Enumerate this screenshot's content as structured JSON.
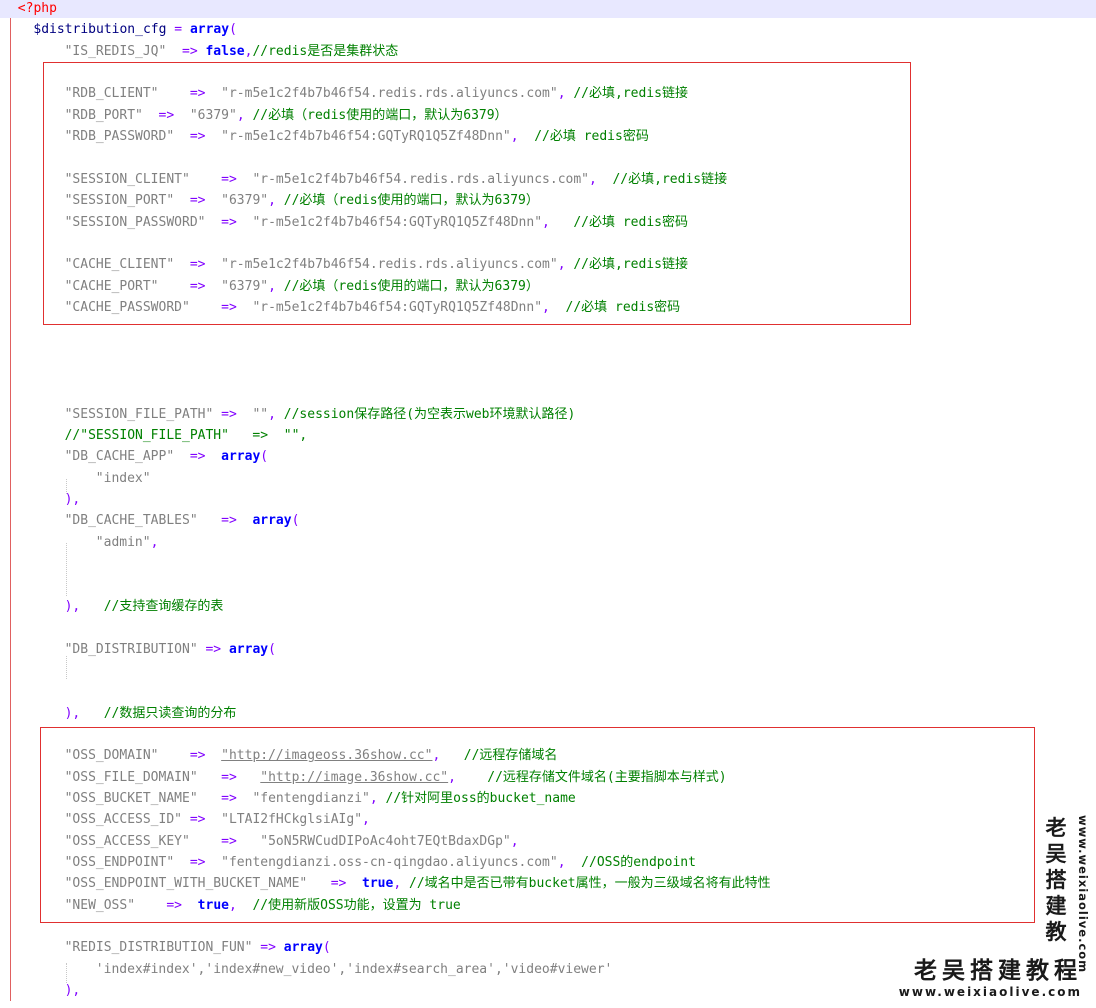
{
  "lines": [
    {
      "indent": 1,
      "segs": [
        {
          "c": "tag",
          "t": "<?php"
        }
      ]
    },
    {
      "indent": 3,
      "segs": [
        {
          "c": "var",
          "t": "$distribution_cfg"
        },
        {
          "c": "op",
          "t": " = "
        },
        {
          "c": "kw",
          "t": "array"
        },
        {
          "c": "op",
          "t": "("
        }
      ]
    },
    {
      "indent": 7,
      "segs": [
        {
          "c": "str",
          "t": "\"IS_REDIS_JQ\""
        },
        {
          "c": "op",
          "t": "  => "
        },
        {
          "c": "kw",
          "t": "false"
        },
        {
          "c": "op",
          "t": ","
        },
        {
          "c": "cm",
          "t": "//redis是否是集群状态"
        }
      ]
    },
    {
      "indent": 0,
      "segs": []
    },
    {
      "indent": 7,
      "segs": [
        {
          "c": "str",
          "t": "\"RDB_CLIENT\""
        },
        {
          "c": "op",
          "t": "    =>  "
        },
        {
          "c": "str",
          "t": "\"r-m5e1c2f4b7b46f54.redis.rds.aliyuncs.com\""
        },
        {
          "c": "op",
          "t": ", "
        },
        {
          "c": "cm",
          "t": "//必填,redis链接"
        }
      ]
    },
    {
      "indent": 7,
      "segs": [
        {
          "c": "str",
          "t": "\"RDB_PORT\""
        },
        {
          "c": "op",
          "t": "  =>  "
        },
        {
          "c": "str",
          "t": "\"6379\""
        },
        {
          "c": "op",
          "t": ", "
        },
        {
          "c": "cm",
          "t": "//必填（redis使用的端口，默认为6379）"
        }
      ]
    },
    {
      "indent": 7,
      "segs": [
        {
          "c": "str",
          "t": "\"RDB_PASSWORD\""
        },
        {
          "c": "op",
          "t": "  =>  "
        },
        {
          "c": "str",
          "t": "\"r-m5e1c2f4b7b46f54:GQTyRQ1Q5Zf48Dnn\""
        },
        {
          "c": "op",
          "t": ",  "
        },
        {
          "c": "cm",
          "t": "//必填 redis密码"
        }
      ]
    },
    {
      "indent": 0,
      "segs": []
    },
    {
      "indent": 7,
      "segs": [
        {
          "c": "str",
          "t": "\"SESSION_CLIENT\""
        },
        {
          "c": "op",
          "t": "    =>  "
        },
        {
          "c": "str",
          "t": "\"r-m5e1c2f4b7b46f54.redis.rds.aliyuncs.com\""
        },
        {
          "c": "op",
          "t": ",  "
        },
        {
          "c": "cm",
          "t": "//必填,redis链接"
        }
      ]
    },
    {
      "indent": 7,
      "segs": [
        {
          "c": "str",
          "t": "\"SESSION_PORT\""
        },
        {
          "c": "op",
          "t": "  =>  "
        },
        {
          "c": "str",
          "t": "\"6379\""
        },
        {
          "c": "op",
          "t": ", "
        },
        {
          "c": "cm",
          "t": "//必填（redis使用的端口，默认为6379）"
        }
      ]
    },
    {
      "indent": 7,
      "segs": [
        {
          "c": "str",
          "t": "\"SESSION_PASSWORD\""
        },
        {
          "c": "op",
          "t": "  =>  "
        },
        {
          "c": "str",
          "t": "\"r-m5e1c2f4b7b46f54:GQTyRQ1Q5Zf48Dnn\""
        },
        {
          "c": "op",
          "t": ",   "
        },
        {
          "c": "cm",
          "t": "//必填 redis密码"
        }
      ]
    },
    {
      "indent": 0,
      "segs": []
    },
    {
      "indent": 7,
      "segs": [
        {
          "c": "str",
          "t": "\"CACHE_CLIENT\""
        },
        {
          "c": "op",
          "t": "  =>  "
        },
        {
          "c": "str",
          "t": "\"r-m5e1c2f4b7b46f54.redis.rds.aliyuncs.com\""
        },
        {
          "c": "op",
          "t": ", "
        },
        {
          "c": "cm",
          "t": "//必填,redis链接"
        }
      ]
    },
    {
      "indent": 7,
      "segs": [
        {
          "c": "str",
          "t": "\"CACHE_PORT\""
        },
        {
          "c": "op",
          "t": "    =>  "
        },
        {
          "c": "str",
          "t": "\"6379\""
        },
        {
          "c": "op",
          "t": ", "
        },
        {
          "c": "cm",
          "t": "//必填（redis使用的端口，默认为6379）"
        }
      ]
    },
    {
      "indent": 7,
      "segs": [
        {
          "c": "str",
          "t": "\"CACHE_PASSWORD\""
        },
        {
          "c": "op",
          "t": "    =>  "
        },
        {
          "c": "str",
          "t": "\"r-m5e1c2f4b7b46f54:GQTyRQ1Q5Zf48Dnn\""
        },
        {
          "c": "op",
          "t": ",  "
        },
        {
          "c": "cm",
          "t": "//必填 redis密码"
        }
      ]
    },
    {
      "indent": 0,
      "segs": []
    },
    {
      "indent": 0,
      "segs": []
    },
    {
      "indent": 0,
      "segs": []
    },
    {
      "indent": 0,
      "segs": []
    },
    {
      "indent": 7,
      "segs": [
        {
          "c": "str",
          "t": "\"SESSION_FILE_PATH\""
        },
        {
          "c": "op",
          "t": " =>  "
        },
        {
          "c": "str",
          "t": "\"\""
        },
        {
          "c": "op",
          "t": ", "
        },
        {
          "c": "cm",
          "t": "//session保存路径(为空表示web环境默认路径)"
        }
      ]
    },
    {
      "indent": 7,
      "segs": [
        {
          "c": "cm",
          "t": "//\"SESSION_FILE_PATH\"   =>  \"\","
        }
      ]
    },
    {
      "indent": 7,
      "segs": [
        {
          "c": "str",
          "t": "\"DB_CACHE_APP\""
        },
        {
          "c": "op",
          "t": "  =>  "
        },
        {
          "c": "kw",
          "t": "array"
        },
        {
          "c": "op",
          "t": "("
        }
      ]
    },
    {
      "indent": 11,
      "segs": [
        {
          "c": "str",
          "t": "\"index\""
        }
      ]
    },
    {
      "indent": 7,
      "segs": [
        {
          "c": "op",
          "t": "),"
        }
      ]
    },
    {
      "indent": 7,
      "segs": [
        {
          "c": "str",
          "t": "\"DB_CACHE_TABLES\""
        },
        {
          "c": "op",
          "t": "   =>  "
        },
        {
          "c": "kw",
          "t": "array"
        },
        {
          "c": "op",
          "t": "("
        }
      ]
    },
    {
      "indent": 11,
      "segs": [
        {
          "c": "str",
          "t": "\"admin\""
        },
        {
          "c": "op",
          "t": ","
        }
      ]
    },
    {
      "indent": 0,
      "segs": []
    },
    {
      "indent": 0,
      "segs": []
    },
    {
      "indent": 7,
      "segs": [
        {
          "c": "op",
          "t": "),   "
        },
        {
          "c": "cm",
          "t": "//支持查询缓存的表"
        }
      ]
    },
    {
      "indent": 0,
      "segs": []
    },
    {
      "indent": 7,
      "segs": [
        {
          "c": "str",
          "t": "\"DB_DISTRIBUTION\""
        },
        {
          "c": "op",
          "t": " => "
        },
        {
          "c": "kw",
          "t": "array"
        },
        {
          "c": "op",
          "t": "("
        }
      ]
    },
    {
      "indent": 0,
      "segs": []
    },
    {
      "indent": 0,
      "segs": []
    },
    {
      "indent": 7,
      "segs": [
        {
          "c": "op",
          "t": "),   "
        },
        {
          "c": "cm",
          "t": "//数据只读查询的分布"
        }
      ]
    },
    {
      "indent": 0,
      "segs": []
    },
    {
      "indent": 7,
      "segs": [
        {
          "c": "str",
          "t": "\"OSS_DOMAIN\""
        },
        {
          "c": "op",
          "t": "    =>  "
        },
        {
          "c": "lnk",
          "t": "\"http://imageoss.36show.cc\""
        },
        {
          "c": "op",
          "t": ",   "
        },
        {
          "c": "cm",
          "t": "//远程存储域名"
        }
      ]
    },
    {
      "indent": 7,
      "segs": [
        {
          "c": "str",
          "t": "\"OSS_FILE_DOMAIN\""
        },
        {
          "c": "op",
          "t": "   =>   "
        },
        {
          "c": "lnk",
          "t": "\"http://image.36show.cc\""
        },
        {
          "c": "op",
          "t": ",    "
        },
        {
          "c": "cm",
          "t": "//远程存储文件域名(主要指脚本与样式)"
        }
      ]
    },
    {
      "indent": 7,
      "segs": [
        {
          "c": "str",
          "t": "\"OSS_BUCKET_NAME\""
        },
        {
          "c": "op",
          "t": "   =>  "
        },
        {
          "c": "str",
          "t": "\"fentengdianzi\""
        },
        {
          "c": "op",
          "t": ", "
        },
        {
          "c": "cm",
          "t": "//针对阿里oss的bucket_name"
        }
      ]
    },
    {
      "indent": 7,
      "segs": [
        {
          "c": "str",
          "t": "\"OSS_ACCESS_ID\""
        },
        {
          "c": "op",
          "t": " =>  "
        },
        {
          "c": "str",
          "t": "\"LTAI2fHCkglsiAIg\""
        },
        {
          "c": "op",
          "t": ","
        }
      ]
    },
    {
      "indent": 7,
      "segs": [
        {
          "c": "str",
          "t": "\"OSS_ACCESS_KEY\""
        },
        {
          "c": "op",
          "t": "    =>   "
        },
        {
          "c": "str",
          "t": "\"5oN5RWCudDIPoAc4oht7EQtBdaxDGp\""
        },
        {
          "c": "op",
          "t": ","
        }
      ]
    },
    {
      "indent": 7,
      "segs": [
        {
          "c": "str",
          "t": "\"OSS_ENDPOINT\""
        },
        {
          "c": "op",
          "t": "  =>  "
        },
        {
          "c": "str",
          "t": "\"fentengdianzi.oss-cn-qingdao.aliyuncs.com\""
        },
        {
          "c": "op",
          "t": ",  "
        },
        {
          "c": "cm",
          "t": "//OSS的endpoint"
        }
      ]
    },
    {
      "indent": 7,
      "segs": [
        {
          "c": "str",
          "t": "\"OSS_ENDPOINT_WITH_BUCKET_NAME\""
        },
        {
          "c": "op",
          "t": "   =>  "
        },
        {
          "c": "kw",
          "t": "true"
        },
        {
          "c": "op",
          "t": ", "
        },
        {
          "c": "cm",
          "t": "//域名中是否已带有bucket属性，一般为三级域名将有此特性"
        }
      ]
    },
    {
      "indent": 7,
      "segs": [
        {
          "c": "str",
          "t": "\"NEW_OSS\""
        },
        {
          "c": "op",
          "t": "    =>  "
        },
        {
          "c": "kw",
          "t": "true"
        },
        {
          "c": "op",
          "t": ",  "
        },
        {
          "c": "cm",
          "t": "//使用新版OSS功能，设置为 true"
        }
      ]
    },
    {
      "indent": 0,
      "segs": []
    },
    {
      "indent": 7,
      "segs": [
        {
          "c": "str",
          "t": "\"REDIS_DISTRIBUTION_FUN\""
        },
        {
          "c": "op",
          "t": " => "
        },
        {
          "c": "kw",
          "t": "array"
        },
        {
          "c": "op",
          "t": "("
        }
      ]
    },
    {
      "indent": 11,
      "segs": [
        {
          "c": "str",
          "t": "'index#index','index#new_video','index#search_area','video#viewer'"
        }
      ]
    },
    {
      "indent": 7,
      "segs": [
        {
          "c": "op",
          "t": "),"
        }
      ]
    }
  ],
  "watermark": {
    "text": "老吴搭建教程",
    "url": "www.weixiaolive.com",
    "color": "#1a1a1a"
  },
  "colors": {
    "keyword": "#0000ff",
    "string": "#808080",
    "operator": "#8000ff",
    "comment": "#008000",
    "variable": "#000080",
    "php_tag": "#ff0000",
    "highlight_box": "#e03030",
    "current_line": "#e8e8ff"
  }
}
